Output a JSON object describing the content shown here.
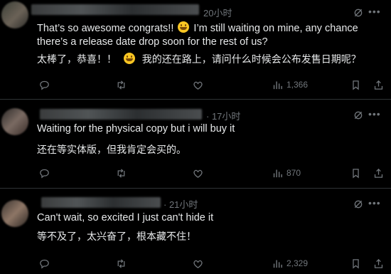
{
  "replies": [
    {
      "time": "20小时",
      "text_en_1": "That’s so awesome congrats!!",
      "text_en_2": "I’m still waiting on mine, any chance there’s a release date drop soon for the rest of us?",
      "text_zh_1": "太棒了，恭喜！！",
      "text_zh_2": "我的还在路上，请问什么时候会公布发售日期呢？",
      "views": "1,366"
    },
    {
      "time": "· 17小时",
      "text_en": "Waiting for the physical copy but i will buy it",
      "text_zh": "还在等实体版，但我肯定会买的。",
      "views": "870"
    },
    {
      "time": "· 21小时",
      "text_en": "Can't wait, so excited I just can't hide it",
      "text_zh": "等不及了，太兴奋了，根本藏不住！",
      "views": "2,329"
    }
  ],
  "icons": {
    "reply": "reply-icon",
    "retweet": "retweet-icon",
    "like": "like-icon",
    "views": "views-icon",
    "grok": "grok-icon",
    "more": "more-icon"
  },
  "colors": {
    "background": "#000000",
    "text": "#e7e9ea",
    "muted": "#71767b",
    "divider": "#2f3336"
  }
}
